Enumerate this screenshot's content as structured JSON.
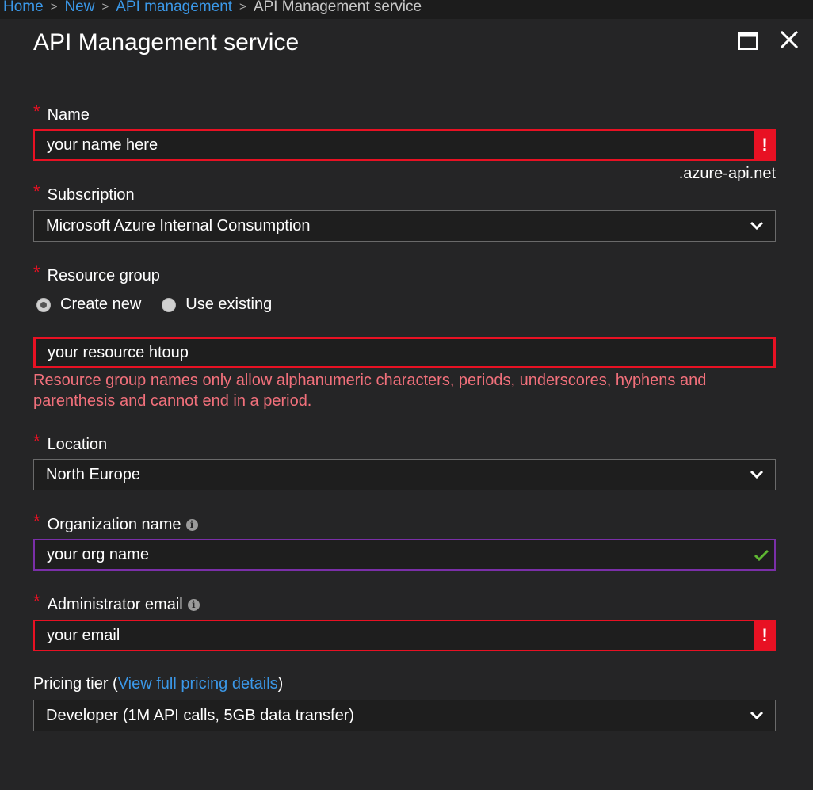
{
  "breadcrumb": {
    "items": [
      "Home",
      "New",
      "API management"
    ],
    "current": "API Management service"
  },
  "blade": {
    "title": "API Management service"
  },
  "form": {
    "required_marker": "*",
    "name": {
      "label": "Name",
      "value": "your name here",
      "suffix": ".azure-api.net",
      "state": "error",
      "badge": "!"
    },
    "subscription": {
      "label": "Subscription",
      "value": "Microsoft Azure Internal Consumption"
    },
    "resource_group": {
      "label": "Resource group",
      "option_create": "Create new",
      "option_existing": "Use existing",
      "selected": "Create new",
      "value": "your resource htoup",
      "state": "error",
      "error_message": "Resource group names only allow alphanumeric characters, periods, underscores, hyphens and parenthesis and cannot end in a period."
    },
    "location": {
      "label": "Location",
      "value": "North Europe"
    },
    "organization": {
      "label": "Organization name",
      "info": "i",
      "value": "your org name",
      "state": "valid"
    },
    "admin_email": {
      "label": "Administrator email",
      "info": "i",
      "value": "your email",
      "state": "error",
      "badge": "!"
    },
    "pricing": {
      "label_prefix": "Pricing tier (",
      "link": "View full pricing details",
      "label_suffix": ")",
      "value": "Developer (1M API calls, 5GB data transfer)"
    }
  },
  "colors": {
    "background": "#252526",
    "error": "#e81123",
    "error_text": "#f1707b",
    "link": "#3b98e8",
    "valid_check": "#5fb832",
    "valid_border": "#7a2fa8"
  }
}
